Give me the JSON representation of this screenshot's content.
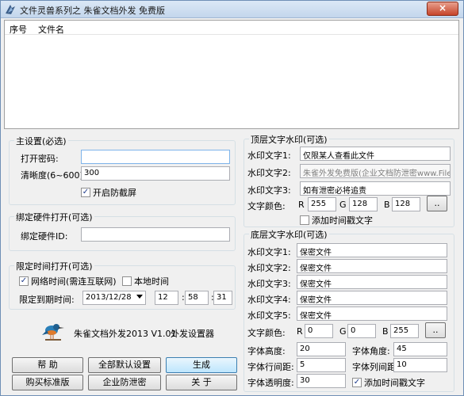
{
  "window": {
    "title": "文件灵兽系列之 朱雀文档外发 免费版",
    "close_label": "×"
  },
  "list": {
    "col_index": "序号",
    "col_filename": "文件名"
  },
  "main_settings": {
    "title": "主设置(必选)",
    "password_label": "打开密码:",
    "password_value": "",
    "clarity_label": "清晰度(6~600):",
    "clarity_value": "300",
    "anti_screenshot_label": "开启防截屏"
  },
  "hardware": {
    "title": "绑定硬件打开(可选)",
    "id_label": "绑定硬件ID:",
    "id_value": ""
  },
  "timed": {
    "title": "限定时间打开(可选)",
    "network_time_label": "网络时间(需连互联网)",
    "local_time_label": "本地时间",
    "expire_label": "限定到期时间:",
    "date_value": "2013/12/28",
    "hour": "12",
    "minute": "58",
    "second": "31"
  },
  "app_info": {
    "version_text": "朱雀文档外发2013 V1.01",
    "settings_text": "外发设置器"
  },
  "buttons": {
    "help": "帮  助",
    "reset": "全部默认设置",
    "generate": "生成",
    "buy": "购买标准版",
    "enterprise": "企业防泄密",
    "about": "关  于"
  },
  "top_watermark": {
    "title": "顶层文字水印(可选)",
    "text1_label": "水印文字1:",
    "text1_value": "仅限某人查看此文件",
    "text2_label": "水印文字2:",
    "text2_value": "朱雀外发免费版(企业文档防泄密www.FileS",
    "text3_label": "水印文字3:",
    "text3_value": "如有泄密必将追责",
    "color_label": "文字颜色:",
    "r_label": "R",
    "r_value": "255",
    "g_label": "G",
    "g_value": "128",
    "b_label": "B",
    "b_value": "128",
    "color_btn": "..",
    "timestamp_label": "添加时间戳文字"
  },
  "bottom_watermark": {
    "title": "底层文字水印(可选)",
    "text1_label": "水印文字1:",
    "text1_value": "保密文件",
    "text2_label": "水印文字2:",
    "text2_value": "保密文件",
    "text3_label": "水印文字3:",
    "text3_value": "保密文件",
    "text4_label": "水印文字4:",
    "text4_value": "保密文件",
    "text5_label": "水印文字5:",
    "text5_value": "保密文件",
    "color_label": "文字颜色:",
    "r_label": "R",
    "r_value": "0",
    "g_label": "G",
    "g_value": "0",
    "b_label": "B",
    "b_value": "255",
    "color_btn": "..",
    "height_label": "字体高度:",
    "height_value": "20",
    "angle_label": "字体角度:",
    "angle_value": "45",
    "line_spacing_label": "字体行间距:",
    "line_spacing_value": "5",
    "col_spacing_label": "字体列间距:",
    "col_spacing_value": "10",
    "opacity_label": "字体透明度:",
    "opacity_value": "30",
    "timestamp_label": "添加时间戳文字"
  }
}
